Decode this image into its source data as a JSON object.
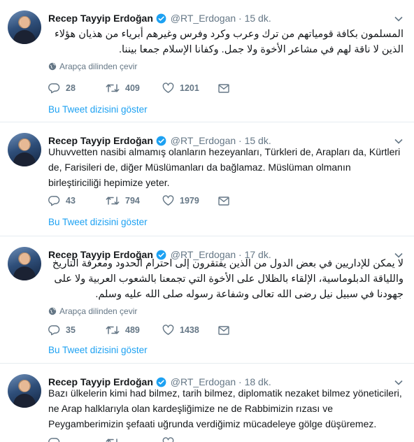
{
  "tweets": [
    {
      "name": "Recep Tayyip Erdoğan",
      "handle": "@RT_Erdogan",
      "separator": "·",
      "time": "15 dk.",
      "text": "المسلمون بكافة قومياتهم من ترك وعرب وكرد وفرس وغيرهم أبرياء من هذيان هؤلاء الذين لا ناقة لهم في مشاعر الأخوة ولا جمل. وكفانا الإسلام جمعا بيننا.",
      "translate_label": "Arapça dilinden çevir",
      "replies": "28",
      "retweets": "409",
      "likes": "1201",
      "thread_label": "Bu Tweet dizisini göster"
    },
    {
      "name": "Recep Tayyip Erdoğan",
      "handle": "@RT_Erdogan",
      "separator": "·",
      "time": "15 dk.",
      "text": "Uhuvvetten nasibi almamış olanların hezeyanları, Türkleri de, Arapları da, Kürtleri de, Farisileri de, diğer Müslümanları da bağlamaz. Müslüman olmanın birleştiriciliği hepimize yeter.",
      "replies": "43",
      "retweets": "794",
      "likes": "1979",
      "thread_label": "Bu Tweet dizisini göster"
    },
    {
      "name": "Recep Tayyip Erdoğan",
      "handle": "@RT_Erdogan",
      "separator": "·",
      "time": "17 dk.",
      "text": "لا يمكن للإداريين في بعض الدول من الذين يفتقرون إلى احترام الحدود ومعرفة التاريخ واللياقة الدبلوماسية، الإلقاء بالظلال على الأخوة التي تجمعنا بالشعوب العربية ولا على جهودنا في سبيل نيل رضى الله تعالى وشفاعة رسوله صلى الله عليه وسلم.",
      "translate_label": "Arapça dilinden çevir",
      "replies": "35",
      "retweets": "489",
      "likes": "1438",
      "thread_label": "Bu Tweet dizisini göster"
    },
    {
      "name": "Recep Tayyip Erdoğan",
      "handle": "@RT_Erdogan",
      "separator": "·",
      "time": "18 dk.",
      "text": "Bazı ülkelerin kimi had bilmez, tarih bilmez, diplomatik nezaket bilmez yöneticileri, ne Arap halklarıyla olan kardeşliğimize ne de Rabbimizin rızası ve Peygamberimizin şefaati uğrunda verdiğimiz mücadeleye gölge düşüremez."
    }
  ],
  "colors": {
    "link": "#1da1f2",
    "muted": "#657786",
    "text": "#14171a",
    "divider": "#e6ecf0"
  }
}
